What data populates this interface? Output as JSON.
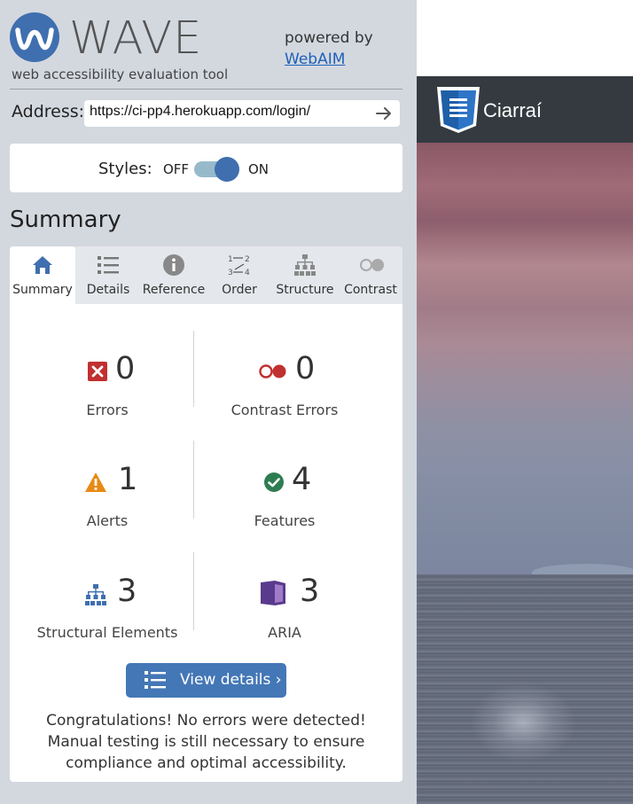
{
  "header": {
    "logo_text": "WAVE",
    "tagline": "web accessibility evaluation tool",
    "powered_by": "powered by",
    "webaim_link": "WebAIM"
  },
  "address": {
    "label": "Address:",
    "value": "https://ci-pp4.herokuapp.com/login/"
  },
  "styles": {
    "label": "Styles:",
    "off": "OFF",
    "on": "ON",
    "state": "on"
  },
  "summary_heading": "Summary",
  "tabs": [
    {
      "label": "Summary",
      "icon": "home-icon",
      "active": true
    },
    {
      "label": "Details",
      "icon": "list-icon",
      "active": false
    },
    {
      "label": "Reference",
      "icon": "info-icon",
      "active": false
    },
    {
      "label": "Order",
      "icon": "order-icon",
      "active": false
    },
    {
      "label": "Structure",
      "icon": "structure-icon",
      "active": false
    },
    {
      "label": "Contrast",
      "icon": "contrast-icon",
      "active": false
    }
  ],
  "stats": {
    "errors": {
      "count": "0",
      "label": "Errors",
      "icon": "error-icon"
    },
    "contrast_errors": {
      "count": "0",
      "label": "Contrast Errors",
      "icon": "contrast-error-icon"
    },
    "alerts": {
      "count": "1",
      "label": "Alerts",
      "icon": "alert-icon"
    },
    "features": {
      "count": "4",
      "label": "Features",
      "icon": "feature-icon"
    },
    "structural": {
      "count": "3",
      "label": "Structural Elements",
      "icon": "structure-icon"
    },
    "aria": {
      "count": "3",
      "label": "ARIA",
      "icon": "aria-icon"
    }
  },
  "view_details_button": "View details ›",
  "congrats_message": "Congratulations! No errors were detected! Manual testing is still necessary to ensure compliance and optimal accessibility.",
  "preview": {
    "brand_name": "Ciarraí"
  },
  "colors": {
    "accent": "#3f6faf",
    "button": "#4477b6",
    "error": "#c03030",
    "alert": "#e88a14",
    "feature": "#2e7d52",
    "aria": "#5a3a8c",
    "nav_bg": "#343a40"
  }
}
